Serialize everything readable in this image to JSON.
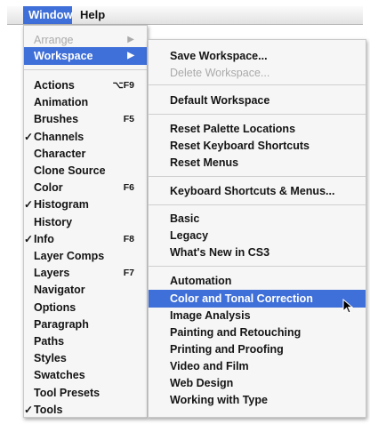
{
  "menubar": {
    "window": "Window",
    "help": "Help"
  },
  "window_menu": {
    "arrange": "Arrange",
    "workspace": "Workspace",
    "submenu_arrow": "▶",
    "items": [
      {
        "label": "Actions",
        "shortcut": "⌥F9",
        "checked": false
      },
      {
        "label": "Animation",
        "shortcut": "",
        "checked": false
      },
      {
        "label": "Brushes",
        "shortcut": "F5",
        "checked": false
      },
      {
        "label": "Channels",
        "shortcut": "",
        "checked": true
      },
      {
        "label": "Character",
        "shortcut": "",
        "checked": false
      },
      {
        "label": "Clone Source",
        "shortcut": "",
        "checked": false
      },
      {
        "label": "Color",
        "shortcut": "F6",
        "checked": false
      },
      {
        "label": "Histogram",
        "shortcut": "",
        "checked": true
      },
      {
        "label": "History",
        "shortcut": "",
        "checked": false
      },
      {
        "label": "Info",
        "shortcut": "F8",
        "checked": true
      },
      {
        "label": "Layer Comps",
        "shortcut": "",
        "checked": false
      },
      {
        "label": "Layers",
        "shortcut": "F7",
        "checked": false
      },
      {
        "label": "Navigator",
        "shortcut": "",
        "checked": false
      },
      {
        "label": "Options",
        "shortcut": "",
        "checked": false
      },
      {
        "label": "Paragraph",
        "shortcut": "",
        "checked": false
      },
      {
        "label": "Paths",
        "shortcut": "",
        "checked": false
      },
      {
        "label": "Styles",
        "shortcut": "",
        "checked": false
      },
      {
        "label": "Swatches",
        "shortcut": "",
        "checked": false
      },
      {
        "label": "Tool Presets",
        "shortcut": "",
        "checked": false
      },
      {
        "label": "Tools",
        "shortcut": "",
        "checked": true
      }
    ],
    "check_mark": "✓"
  },
  "workspace_menu": {
    "save_workspace": "Save Workspace...",
    "delete_workspace": "Delete Workspace...",
    "default_workspace": "Default Workspace",
    "reset_palette_locations": "Reset Palette Locations",
    "reset_keyboard_shortcuts": "Reset Keyboard Shortcuts",
    "reset_menus": "Reset Menus",
    "keyboard_shortcuts_menus": "Keyboard Shortcuts & Menus...",
    "basic": "Basic",
    "legacy": "Legacy",
    "whats_new": "What's New in CS3",
    "automation": "Automation",
    "color_tonal_correction": "Color and Tonal Correction",
    "image_analysis": "Image Analysis",
    "painting_retouching": "Painting and Retouching",
    "printing_proofing": "Printing and Proofing",
    "video_film": "Video and Film",
    "web_design": "Web Design",
    "working_with_type": "Working with Type"
  },
  "colors": {
    "highlight": "#3f6fd8",
    "disabled": "#aaaaaa"
  }
}
